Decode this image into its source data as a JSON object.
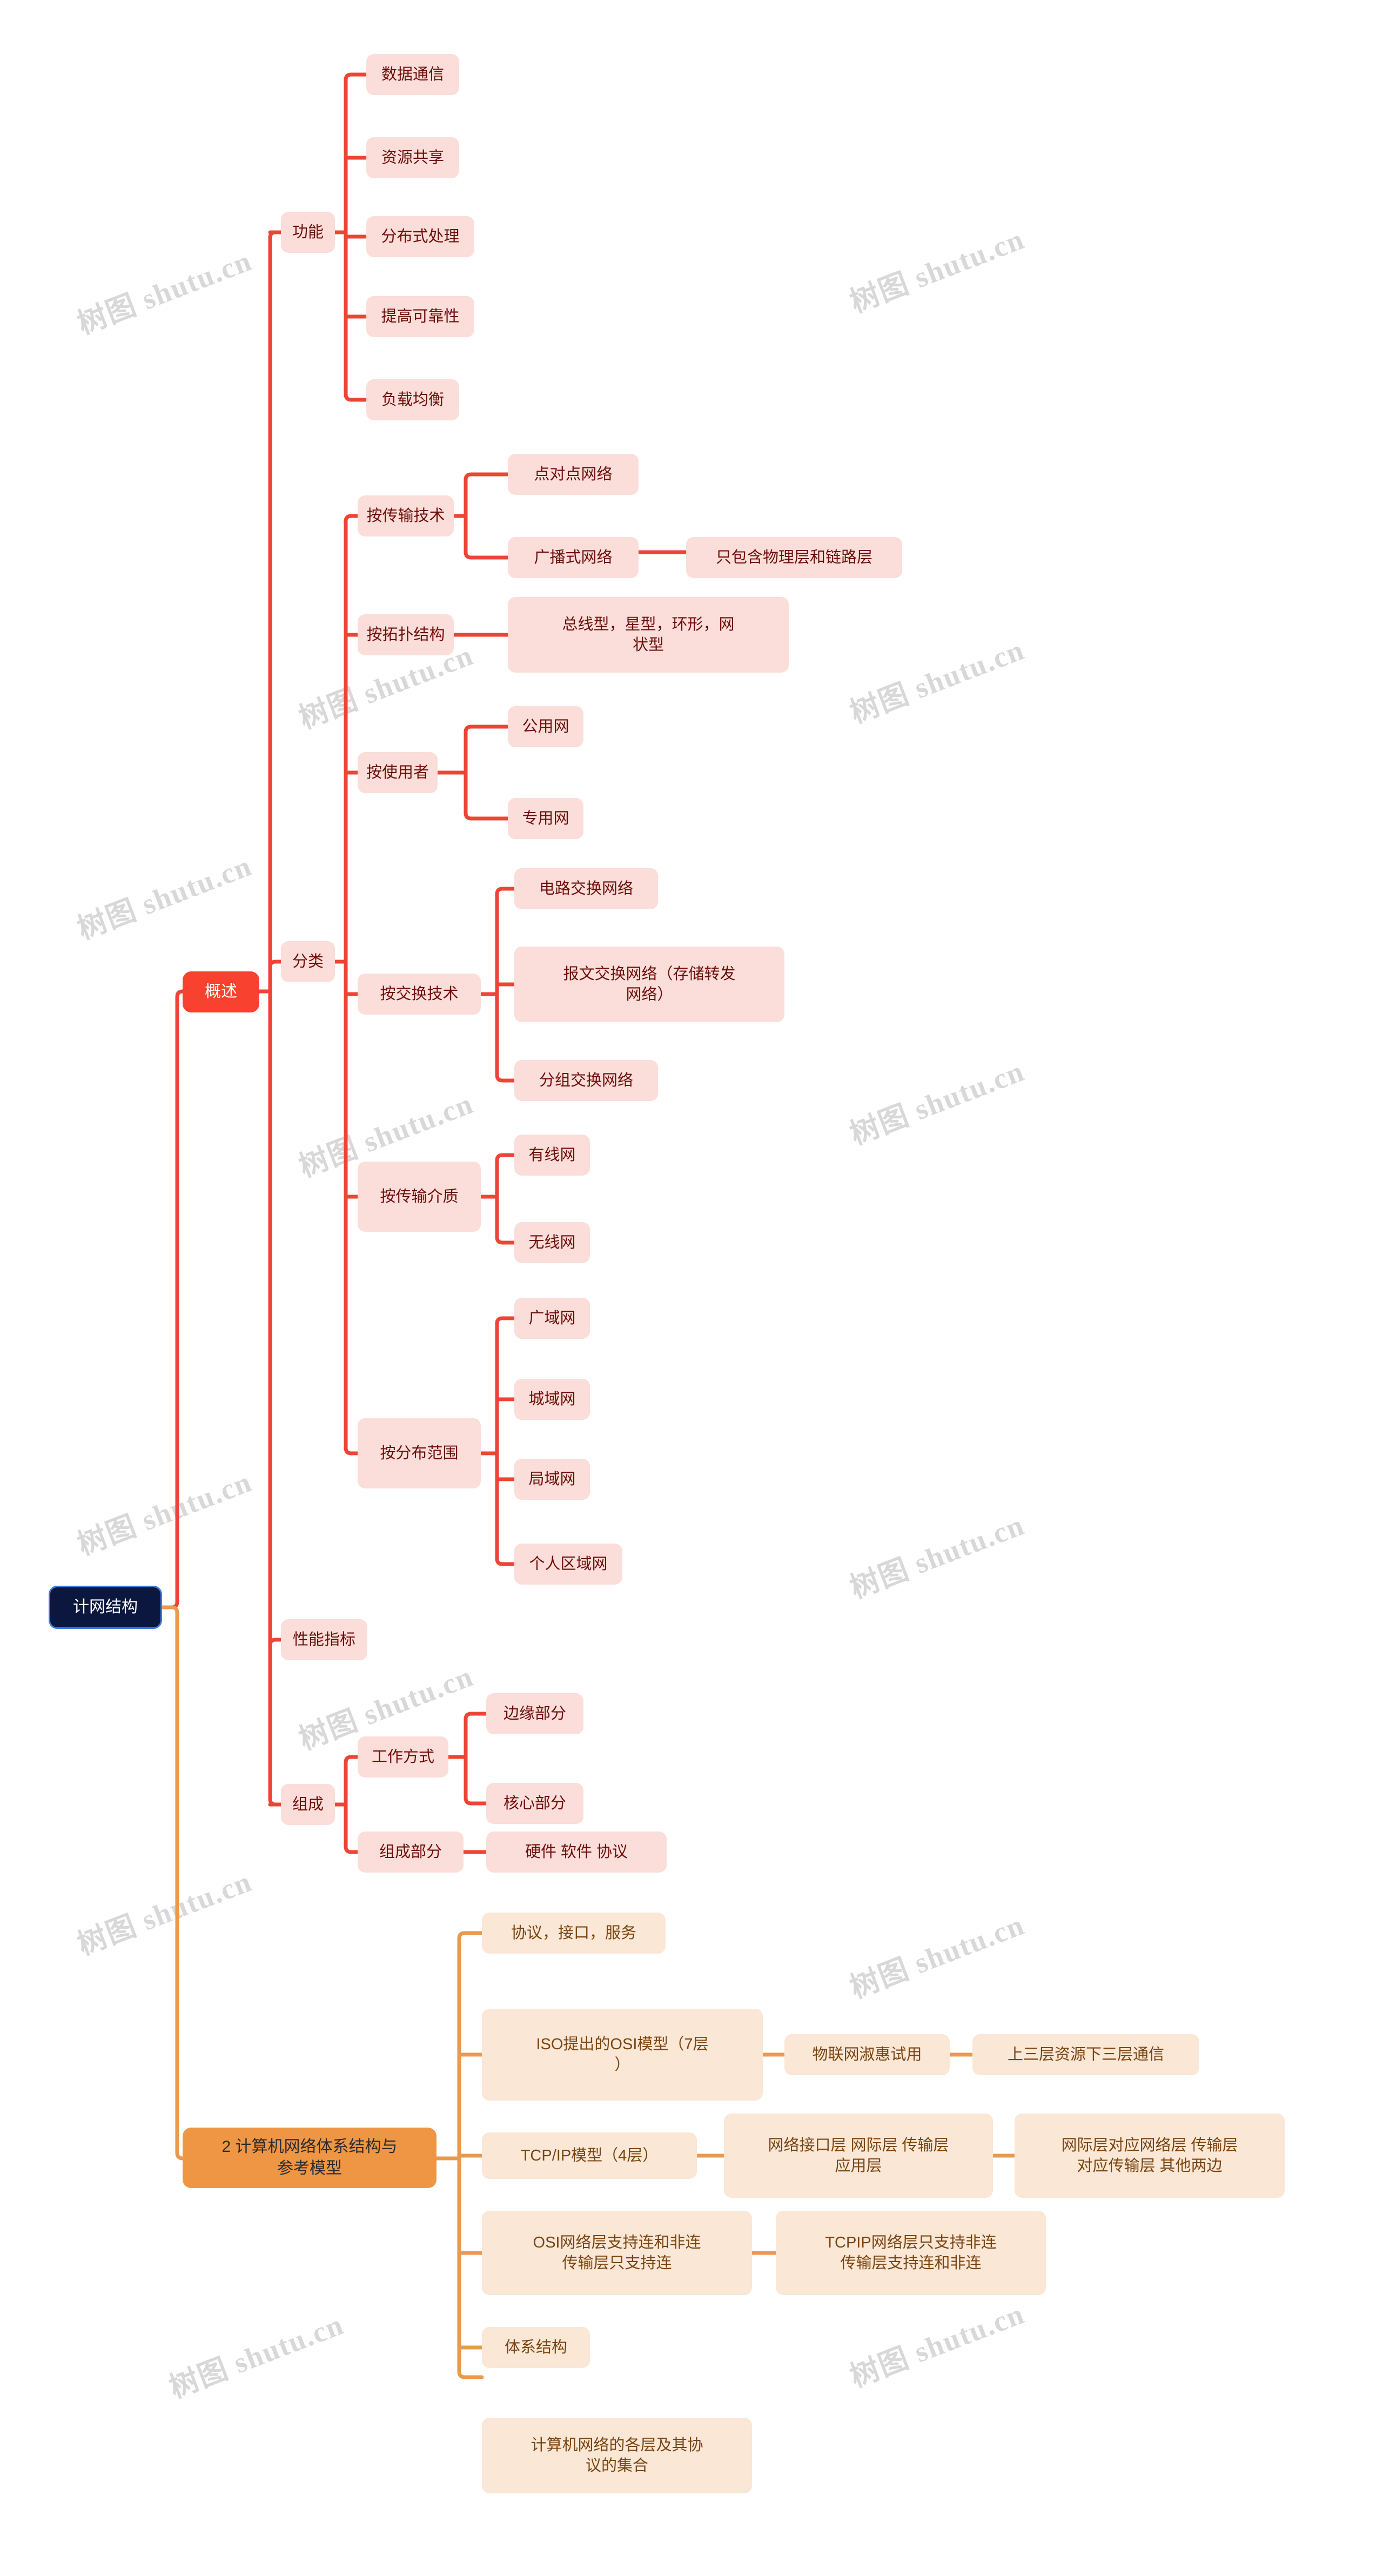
{
  "meta": {
    "watermark_text": "树图 shutu.cn",
    "colors": {
      "root_fill": "#0c1740",
      "root_border": "#3b7de0",
      "branch1_fill": "#f8412f",
      "branch2_fill": "#ef9645",
      "red_node_fill": "#fbddd9",
      "red_node_text": "#6e0e0a",
      "orange_node_fill": "#fbe7d5",
      "orange_node_text": "#7a4512",
      "red_link": "#ee4436",
      "orange_link": "#e89a4e"
    }
  },
  "mindmap": {
    "root": "计网结构",
    "branch_overview": "概述",
    "branch_architecture": "2 计算机网络体系结构与\n参考模型",
    "nodes": {
      "gongneng": "功能",
      "gongneng_1": "数据通信",
      "gongneng_2": "资源共享",
      "gongneng_3": "分布式处理",
      "gongneng_4": "提高可靠性",
      "gongneng_5": "负载均衡",
      "fenlei": "分类",
      "an_chuanshu_jishu": "按传输技术",
      "diandui_dian": "点对点网络",
      "guangbo_shi": "广播式网络",
      "guangbo_shi_note": "只包含物理层和链路层",
      "an_tuopu": "按拓扑结构",
      "an_tuopu_note": "总线型，星型，环形，网\n状型",
      "an_shiyongzhe": "按使用者",
      "gongyong_wang": "公用网",
      "zhuanyong_wang": "专用网",
      "an_jiaohuan": "按交换技术",
      "dianlu_jiaohuan": "电路交换网络",
      "baowen_jiaohuan": "报文交换网络（存储转发\n网络）",
      "fenzu_jiaohuan": "分组交换网络",
      "an_jiezhi": "按传输介质",
      "youxian_wang": "有线网",
      "wuxian_wang": "无线网",
      "an_fanwei": "按分布范围",
      "guangyu_wang": "广域网",
      "chengyu_wang": "城域网",
      "juyu_wang": "局域网",
      "geren_quyu_wang": "个人区域网",
      "xingneng_zhibiao": "性能指标",
      "zucheng": "组成",
      "gongzuo_fangshi": "工作方式",
      "bianyuan_bufen": "边缘部分",
      "hexin_bufen": "核心部分",
      "zucheng_bufen": "组成部分",
      "zucheng_bufen_note": "硬件 软件 协议",
      "xieyi_jiekou_fuwu": "协议，接口，服务",
      "osi_model": "ISO提出的OSI模型（7层\n）",
      "osi_note1": "物联网淑惠试用",
      "osi_note2": "上三层资源下三层通信",
      "tcpip_model": "TCP/IP模型（4层）",
      "tcpip_layers": "网络接口层 网际层 传输层\n应用层",
      "tcpip_layers_note": "网际层对应网络层 传输层\n对应传输层 其他两边",
      "osi_conn": "OSI网络层支持连和非连\n传输层只支持连",
      "tcpip_conn": "TCPIP网络层只支持非连\n传输层支持连和非连",
      "tixi_jiegou": "体系结构",
      "tixi_jiegou_note": "计算机网络的各层及其协\n议的集合"
    }
  }
}
